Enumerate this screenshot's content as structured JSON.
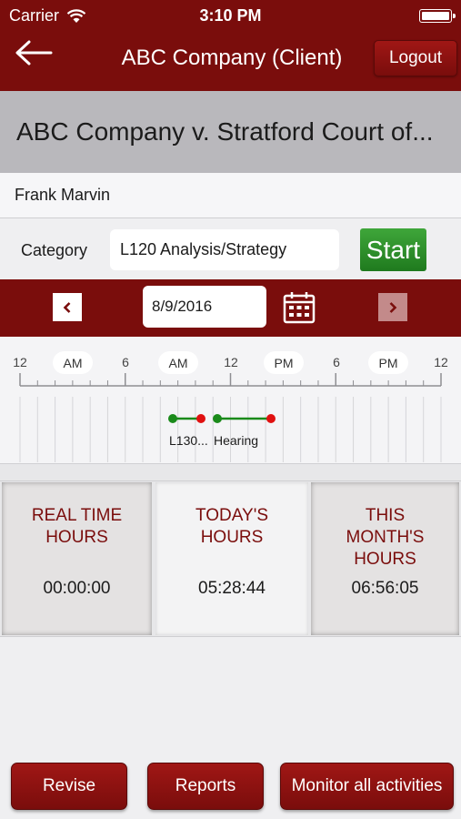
{
  "status_bar": {
    "carrier": "Carrier",
    "time": "3:10 PM"
  },
  "header": {
    "title": "ABC Company (Client)",
    "logout_label": "Logout"
  },
  "case": {
    "title": "ABC Company  v. Stratford Court of..."
  },
  "client": {
    "name": "Frank Marvin"
  },
  "category": {
    "label": "Category",
    "value": "L120  Analysis/Strategy",
    "start_label": "Start"
  },
  "date_nav": {
    "date": "8/9/2016"
  },
  "timeline": {
    "ticks": [
      "12",
      "6",
      "12",
      "6",
      "12"
    ],
    "pills": [
      "AM",
      "AM",
      "PM",
      "PM"
    ],
    "events": [
      {
        "label": "L130...",
        "start_color": "#1a8a1a",
        "end_color": "#e01010"
      },
      {
        "label": "Hearing",
        "start_color": "#1a8a1a",
        "end_color": "#e01010"
      }
    ]
  },
  "stats": [
    {
      "label_line1": "REAL TIME",
      "label_line2": "HOURS",
      "label_line3": "",
      "value": "00:00:00"
    },
    {
      "label_line1": "TODAY'S",
      "label_line2": "HOURS",
      "label_line3": "",
      "value": "05:28:44"
    },
    {
      "label_line1": "THIS",
      "label_line2": "MONTH'S",
      "label_line3": "HOURS",
      "value": "06:56:05"
    }
  ],
  "actions": {
    "revise": "Revise",
    "reports": "Reports",
    "monitor": "Monitor all activities"
  },
  "colors": {
    "brand": "#7a0d0c",
    "accent_green": "#2e8f2b",
    "stat_label": "#7a0d0c"
  }
}
